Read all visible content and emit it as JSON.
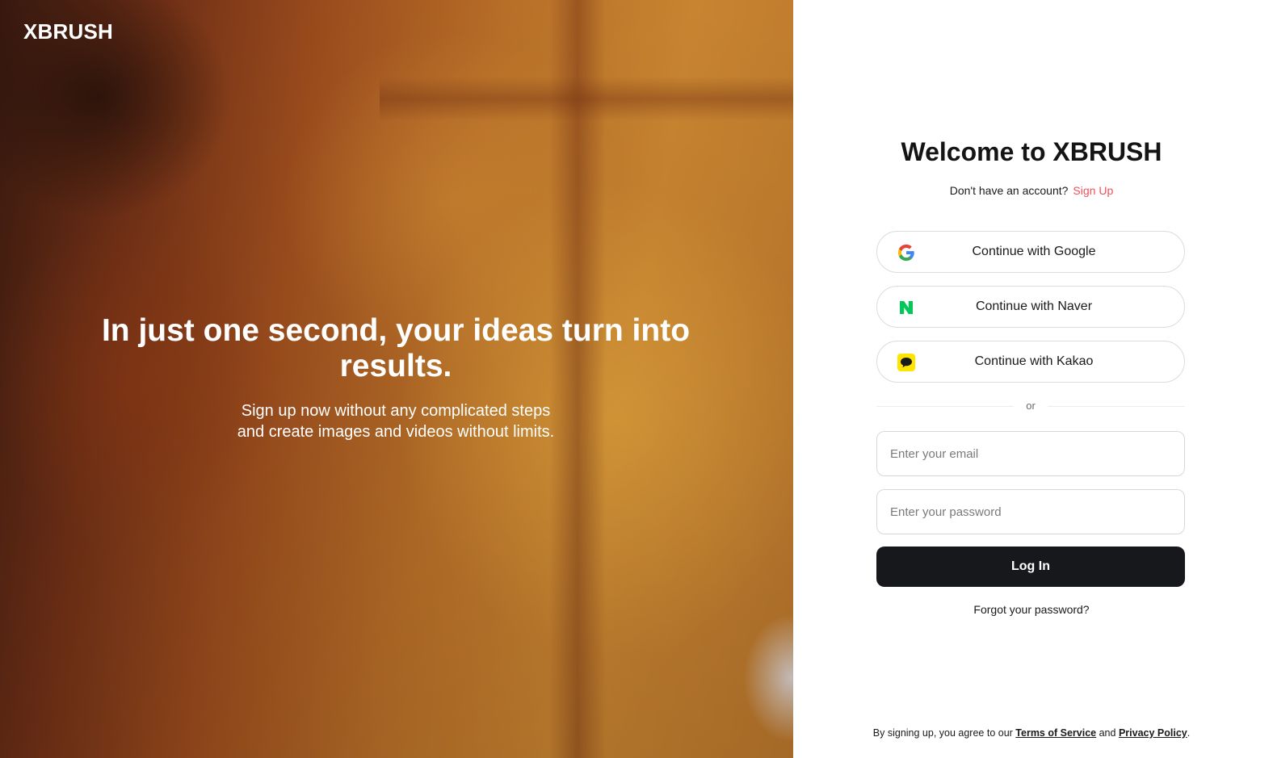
{
  "brand": {
    "logo_text": "XBRUSH"
  },
  "hero": {
    "title": "In just one second, your ideas turn into results.",
    "subtitle_line1": "Sign up now without any complicated steps",
    "subtitle_line2": "and create images and videos without limits."
  },
  "login": {
    "heading": "Welcome to XBRUSH",
    "no_account_text": "Don't have an account?",
    "signup_link": "Sign Up",
    "social_buttons": [
      {
        "label": "Continue with Google",
        "icon": "google-icon"
      },
      {
        "label": "Continue with Naver",
        "icon": "naver-icon"
      },
      {
        "label": "Continue with Kakao",
        "icon": "kakao-icon"
      }
    ],
    "divider_text": "or",
    "email_placeholder": "Enter your email",
    "password_placeholder": "Enter your password",
    "submit_label": "Log In",
    "forgot_password": "Forgot your password?"
  },
  "footer": {
    "terms_prefix": "By signing up, you agree to our",
    "terms_link": "Terms of Service",
    "and_text": "and",
    "privacy_link": "Privacy Policy",
    "suffix": "."
  },
  "colors": {
    "accent_link": "#f0505a",
    "button_dark": "#17181c",
    "naver_green": "#03c75a",
    "kakao_yellow": "#fee500"
  }
}
